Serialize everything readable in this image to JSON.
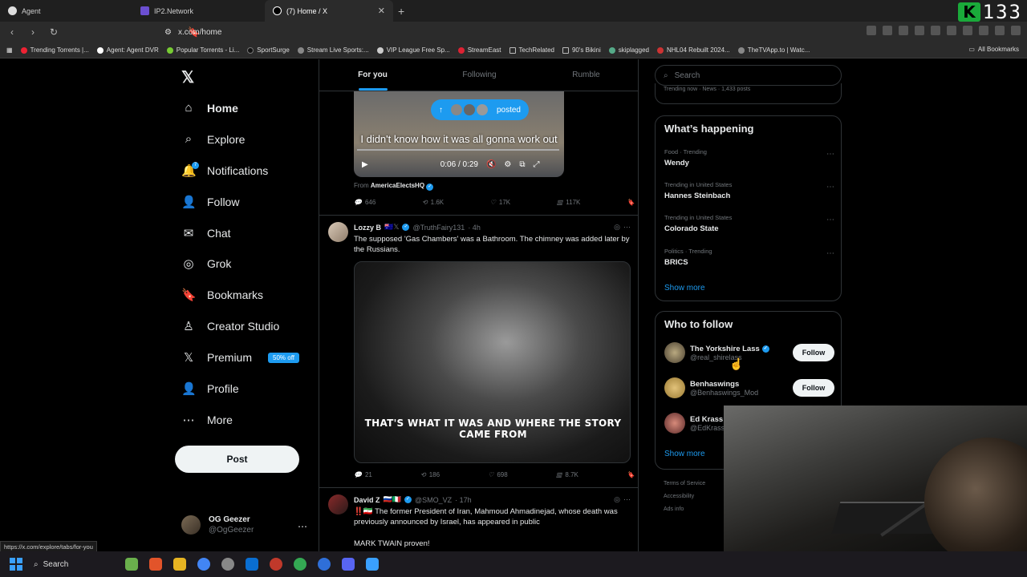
{
  "browser": {
    "tabs": [
      {
        "label": "Agent",
        "active": false
      },
      {
        "label": "IP2.Network",
        "active": false
      },
      {
        "label": "(7) Home / X",
        "active": true
      }
    ],
    "new_tab": "+",
    "url": "x.com/home",
    "counter_badge": "K",
    "counter_value": "133",
    "bookmarks": [
      "Trending Torrents |...",
      "Agent: Agent DVR",
      "Popular Torrents - Li...",
      "SportSurge",
      "Stream Live Sports:...",
      "VIP League Free Sp...",
      "StreamEast",
      "TechRelated",
      "90's Bikini",
      "skiplagged",
      "NHL04 Rebuilt 2024...",
      "TheTVApp.to | Watc..."
    ],
    "all_bookmarks": "All Bookmarks"
  },
  "nav": {
    "logo": "𝕏",
    "items": [
      {
        "label": "Home",
        "icon": "home-icon",
        "glyph": "⌂"
      },
      {
        "label": "Explore",
        "icon": "search-icon",
        "glyph": "⌕"
      },
      {
        "label": "Notifications",
        "icon": "bell-icon",
        "glyph": "🔔"
      },
      {
        "label": "Follow",
        "icon": "add-person-icon",
        "glyph": "👤"
      },
      {
        "label": "Chat",
        "icon": "mail-icon",
        "glyph": "✉"
      },
      {
        "label": "Grok",
        "icon": "grok-icon",
        "glyph": "◎"
      },
      {
        "label": "Bookmarks",
        "icon": "bookmark-icon",
        "glyph": "🔖"
      },
      {
        "label": "Creator Studio",
        "icon": "creator-icon",
        "glyph": "♙"
      },
      {
        "label": "Premium",
        "icon": "x-icon",
        "glyph": "𝕏"
      },
      {
        "label": "Profile",
        "icon": "profile-icon",
        "glyph": "👤"
      },
      {
        "label": "More",
        "icon": "more-circle-icon",
        "glyph": "⋯"
      }
    ],
    "notif_count": "7",
    "premium_badge": "50% off",
    "post_button": "Post",
    "profile": {
      "name": "OG Geezer",
      "handle": "@OgGeezer",
      "more": "⋯"
    }
  },
  "feed": {
    "tabs": [
      "For you",
      "Following",
      "Rumble"
    ],
    "tweet1": {
      "posted_label": "posted",
      "caption": "I didn't know how it was all gonna work out",
      "time": "0:06 / 0:29",
      "from_label": "From",
      "from_source": "AmericaElectsHQ",
      "stats": {
        "replies": "646",
        "reposts": "1.6K",
        "likes": "17K",
        "views": "117K"
      }
    },
    "tweet2": {
      "name": "Lozzy B",
      "flags": "🇦🇺𝕏",
      "handle": "@TruthFairy131",
      "age": "· 4h",
      "text": "The supposed 'Gas Chambers' was a Bathroom. The chimney was added later by the Russians.",
      "video_caption": "THAT'S WHAT IT WAS AND WHERE THE STORY CAME FROM",
      "stats": {
        "replies": "21",
        "reposts": "186",
        "likes": "698",
        "views": "8.7K"
      }
    },
    "tweet3": {
      "name": "David Z",
      "flags": "🇷🇺🇮🇹",
      "handle": "@SMO_VZ",
      "age": "· 17h",
      "text": "‼️🇮🇷 The former President of Iran, Mahmoud Ahmadinejad, whose death was previously announced by Israel, has appeared in public",
      "text2": "MARK TWAIN proven!"
    }
  },
  "sidebar": {
    "search_placeholder": "Search",
    "top_fragment": "Trending now · News · 1,433 posts",
    "happening_title": "What’s happening",
    "trends": [
      {
        "meta": "Food · Trending",
        "name": "Wendy"
      },
      {
        "meta": "Trending in United States",
        "name": "Hannes Steinbach"
      },
      {
        "meta": "Trending in United States",
        "name": "Colorado State"
      },
      {
        "meta": "Politics · Trending",
        "name": "BRICS"
      }
    ],
    "show_more": "Show more",
    "wtf_title": "Who to follow",
    "who_to_follow": [
      {
        "name": "The Yorkshire Lass",
        "handle": "@real_shirelass",
        "verified": true
      },
      {
        "name": "Benhaswings",
        "handle": "@Benhaswings_Mod",
        "verified": false
      },
      {
        "name": "Ed Krass",
        "handle": "@EdKrass",
        "verified": false
      }
    ],
    "follow_label": "Follow",
    "footer": [
      "Terms of Service",
      "Accessibility",
      "Ads info"
    ]
  },
  "status_url": "https://x.com/explore/tabs/for-you",
  "taskbar": {
    "search": "Search"
  },
  "colors": {
    "accent": "#1d9bf0",
    "bg": "#000000",
    "border": "#2f3336",
    "muted": "#71767b"
  }
}
